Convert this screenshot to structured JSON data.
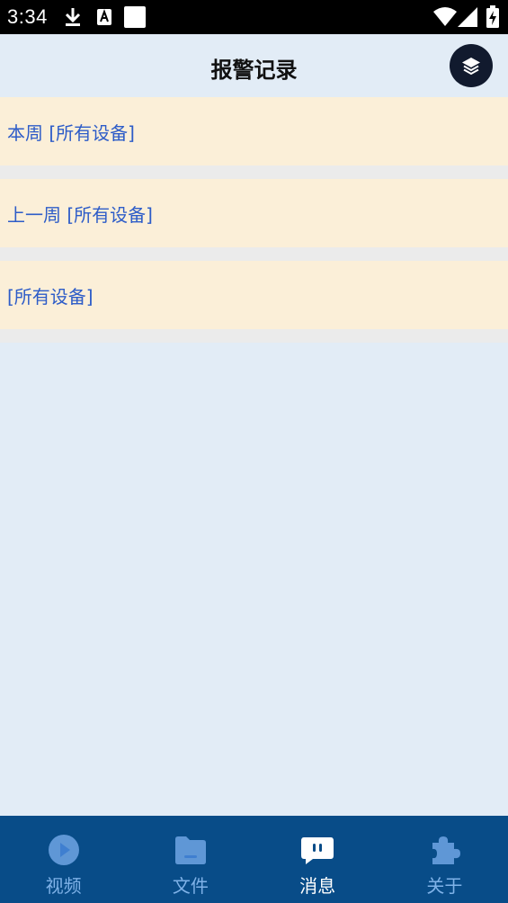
{
  "status_bar": {
    "time": "3:34",
    "icons": [
      "download-icon",
      "a-letter-icon",
      "blank-square-icon",
      "wifi-icon",
      "signal-icon",
      "battery-charging-icon"
    ]
  },
  "header": {
    "title": "报警记录",
    "layers_icon": "layers-icon"
  },
  "list": {
    "items": [
      {
        "label": "本周 [所有设备]"
      },
      {
        "label": "上一周 [所有设备]"
      },
      {
        "label": "[所有设备]"
      }
    ]
  },
  "bottom_nav": {
    "active_index": 2,
    "items": [
      {
        "label": "视频",
        "icon": "video-play-icon"
      },
      {
        "label": "文件",
        "icon": "folder-icon"
      },
      {
        "label": "消息",
        "icon": "message-icon"
      },
      {
        "label": "关于",
        "icon": "puzzle-icon"
      }
    ]
  },
  "colors": {
    "page_background": "#e2ecf6",
    "list_item_background": "#fbefd8",
    "list_text": "#2d5cc8",
    "nav_background": "#084c88",
    "nav_inactive": "#7fb2e8",
    "nav_active": "#ffffff"
  }
}
